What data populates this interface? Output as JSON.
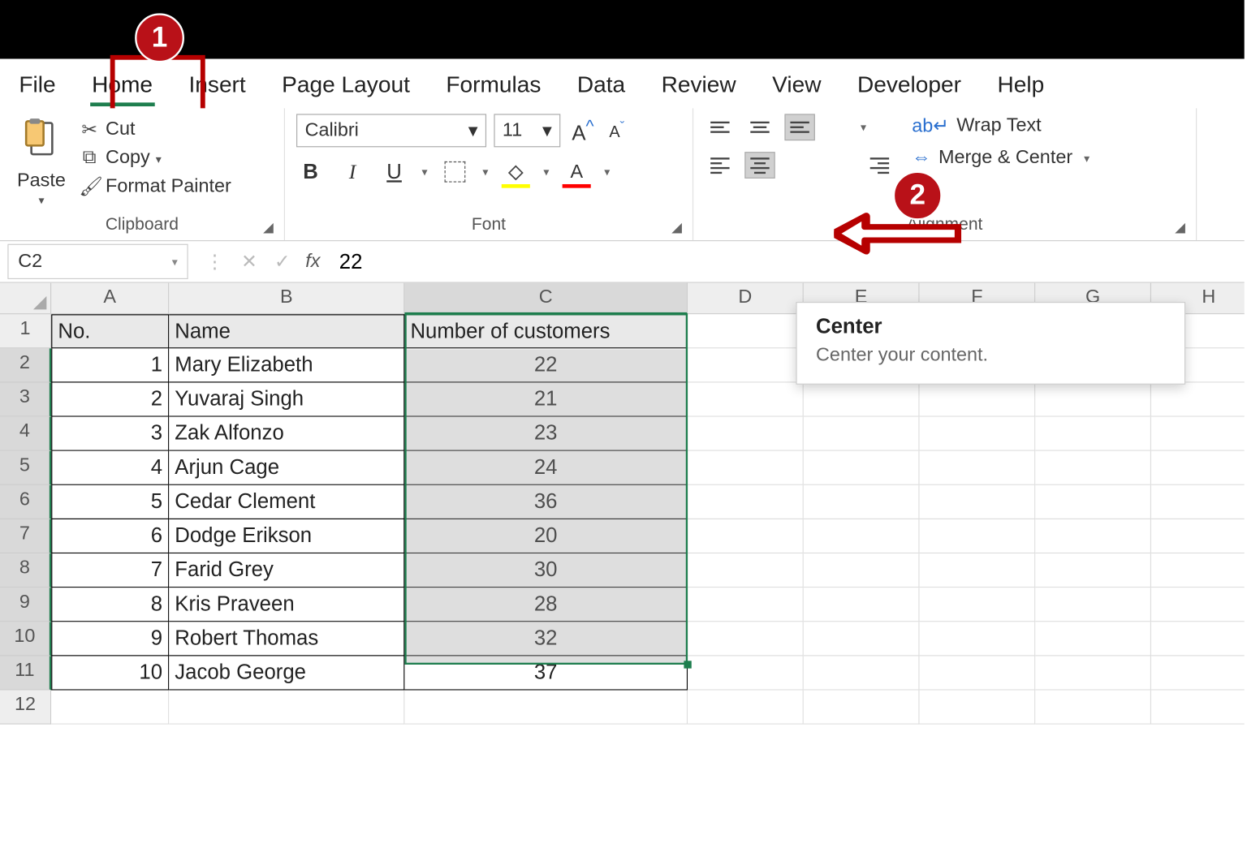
{
  "callouts": {
    "one": "1",
    "two": "2"
  },
  "tabs": {
    "file": "File",
    "home": "Home",
    "insert": "Insert",
    "page_layout": "Page Layout",
    "formulas": "Formulas",
    "data": "Data",
    "review": "Review",
    "view": "View",
    "developer": "Developer",
    "help": "Help"
  },
  "clipboard": {
    "paste": "Paste",
    "cut": "Cut",
    "copy": "Copy",
    "format_painter": "Format Painter",
    "group_label": "Clipboard"
  },
  "font": {
    "name": "Calibri",
    "size": "11",
    "group_label": "Font"
  },
  "alignment": {
    "wrap": "Wrap Text",
    "merge": "Merge & Center",
    "group_label": "Alignment"
  },
  "tooltip": {
    "title": "Center",
    "desc": "Center your content."
  },
  "formula_bar": {
    "name_box": "C2",
    "fx": "fx",
    "value": "22"
  },
  "columns": [
    "A",
    "B",
    "C",
    "D",
    "E",
    "F",
    "G",
    "H"
  ],
  "rows": [
    "1",
    "2",
    "3",
    "4",
    "5",
    "6",
    "7",
    "8",
    "9",
    "10",
    "11",
    "12"
  ],
  "headers": {
    "a": "No.",
    "b": "Name",
    "c": "Number of customers"
  },
  "records": [
    {
      "no": "1",
      "name": "Mary Elizabeth",
      "customers": "22"
    },
    {
      "no": "2",
      "name": "Yuvaraj Singh",
      "customers": "21"
    },
    {
      "no": "3",
      "name": "Zak Alfonzo",
      "customers": "23"
    },
    {
      "no": "4",
      "name": "Arjun Cage",
      "customers": "24"
    },
    {
      "no": "5",
      "name": "Cedar Clement",
      "customers": "36"
    },
    {
      "no": "6",
      "name": "Dodge Erikson",
      "customers": "20"
    },
    {
      "no": "7",
      "name": "Farid Grey",
      "customers": "30"
    },
    {
      "no": "8",
      "name": "Kris Praveen",
      "customers": "28"
    },
    {
      "no": "9",
      "name": "Robert Thomas",
      "customers": "32"
    },
    {
      "no": "10",
      "name": "Jacob George",
      "customers": "37"
    }
  ]
}
